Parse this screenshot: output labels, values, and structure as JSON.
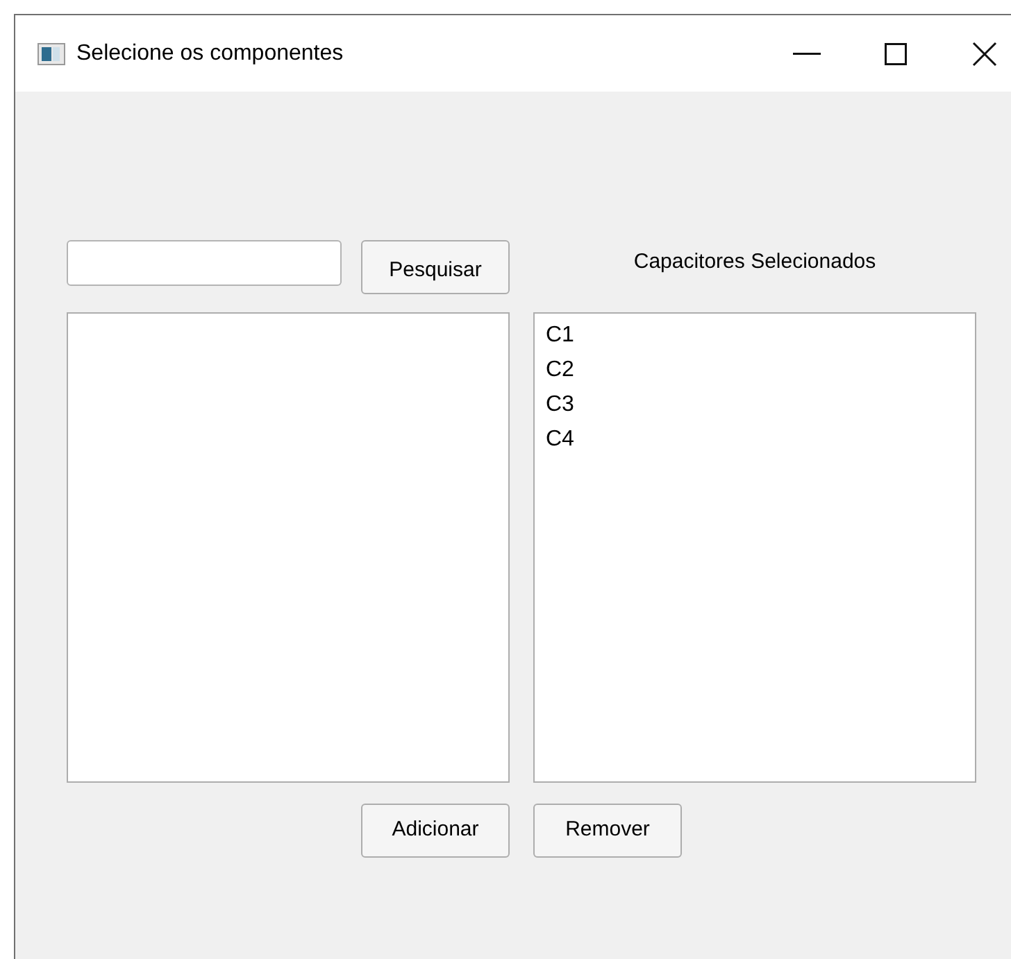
{
  "window": {
    "title": "Selecione os componentes"
  },
  "search_button": "Pesquisar",
  "selected_label": "Capacitores Selecionados",
  "selected_list": {
    "items": [
      "C1",
      "C2",
      "C3",
      "C4"
    ]
  },
  "buttons": [
    "Adicionar",
    "Remover"
  ]
}
